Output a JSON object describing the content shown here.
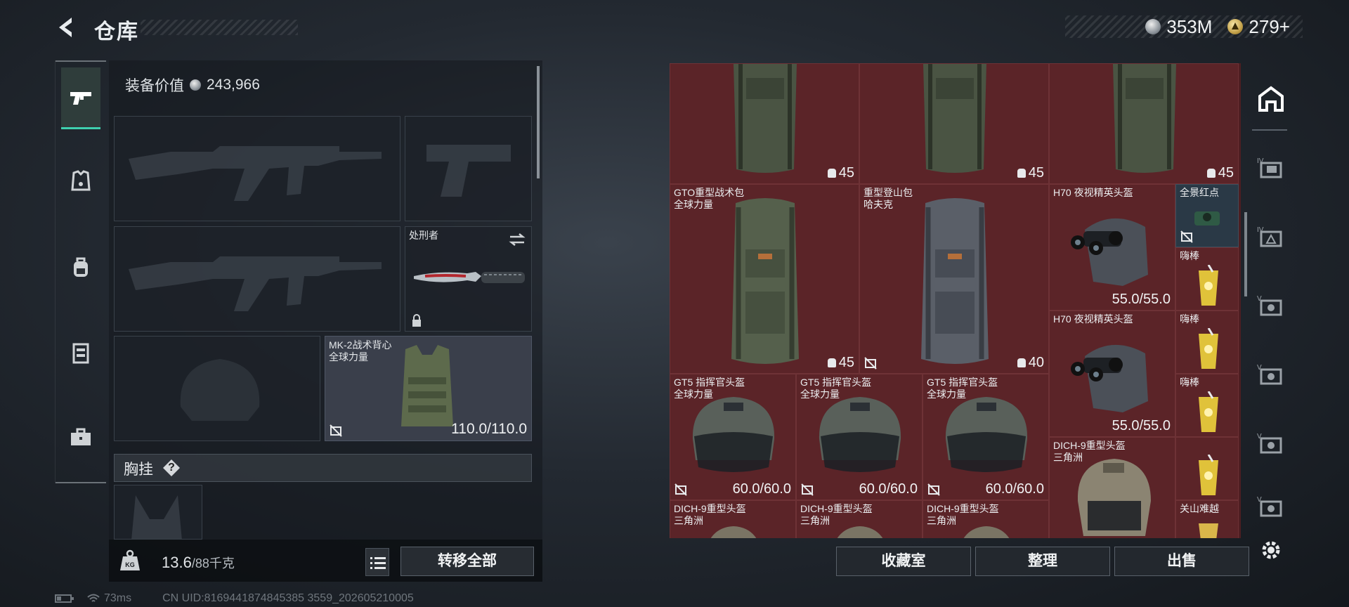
{
  "header": {
    "title": "仓库"
  },
  "currency": {
    "silver": "353M",
    "gold": "279+"
  },
  "left_nav": {
    "items": [
      "weapon-icon",
      "armor-icon",
      "backpack-icon",
      "vest-icon",
      "toolbox-icon"
    ]
  },
  "equipment": {
    "value_label": "装备价值",
    "value": "243,966",
    "melee": {
      "name": "处刑者"
    },
    "armor": {
      "name_line1": "MK-2战术背心",
      "name_line2": "全球力量",
      "durability": "110.0/110.0"
    },
    "chest_rig_label": "胸挂",
    "chest_rig_help": "?",
    "weight": "13.6",
    "weight_max": "/88千克",
    "transfer_all": "转移全部"
  },
  "grid": {
    "top_row": [
      {
        "value": "45"
      },
      {
        "value": "45"
      },
      {
        "value": "45"
      }
    ],
    "backpacks": [
      {
        "line1": "GTO重型战术包",
        "line2": "全球力量",
        "value": "45"
      },
      {
        "line1": "重型登山包",
        "line2": "哈夫克",
        "value": "40"
      }
    ],
    "h70": [
      {
        "line1": "H70 夜视精英头盔",
        "value": "55.0/55.0"
      },
      {
        "line1": "H70 夜视精英头盔",
        "value": "55.0/55.0"
      }
    ],
    "side": [
      {
        "name": "全景红点"
      },
      {
        "name": "嗨棒"
      },
      {
        "name": "嗨棒"
      },
      {
        "name": "嗨棒"
      },
      {
        "name": "关山难越"
      }
    ],
    "gt5": [
      {
        "line1": "GT5 指挥官头盔",
        "line2": "全球力量",
        "value": "60.0/60.0"
      },
      {
        "line1": "GT5 指挥官头盔",
        "line2": "全球力量",
        "value": "60.0/60.0"
      },
      {
        "line1": "GT5 指挥官头盔",
        "line2": "全球力量",
        "value": "60.0/60.0"
      }
    ],
    "dich_big": {
      "line1": "DICH-9重型头盔",
      "line2": "三角洲"
    },
    "dich_small": [
      {
        "line1": "DICH-9重型头盔",
        "line2": "三角洲"
      },
      {
        "line1": "DICH-9重型头盔",
        "line2": "三角洲"
      },
      {
        "line1": "DICH-9重型头盔",
        "line2": "三角洲"
      }
    ]
  },
  "actions": {
    "collection": "收藏室",
    "sort": "整理",
    "sell": "出售"
  },
  "status": {
    "ping": "73ms",
    "uid": "CN UID:8169441874845385 3559_202605210005"
  },
  "colors": {
    "accent": "#3ed0ae",
    "grid_bg": "#5b2428"
  }
}
